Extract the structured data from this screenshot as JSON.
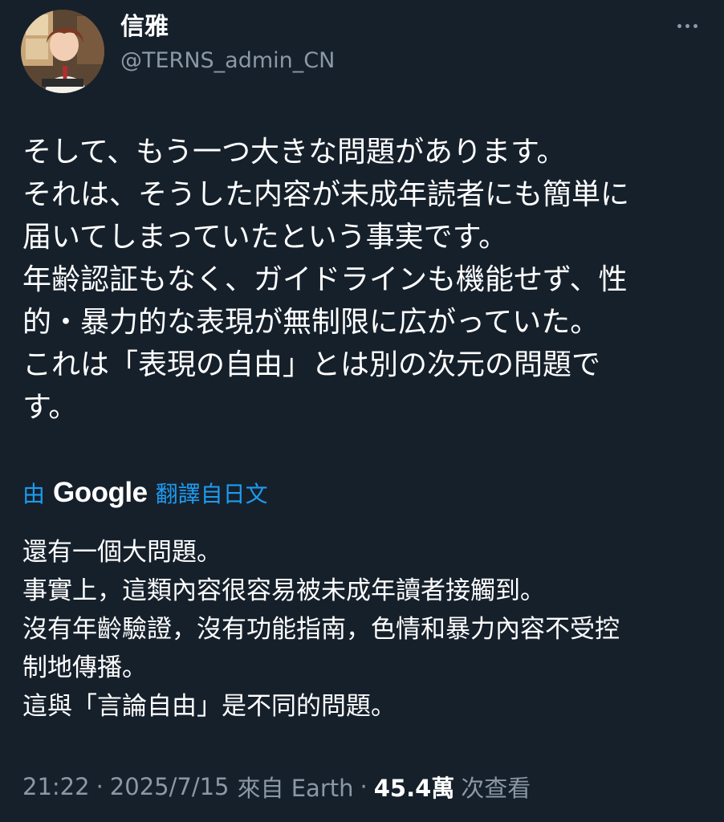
{
  "author": {
    "display_name": "信雅",
    "handle": "@TERNS_admin_CN",
    "avatar_icon": "anime-avatar-portrait"
  },
  "post": {
    "original_text": "そして、もう一つ大きな問題があります。\nそれは、そうした内容が未成年読者にも簡単に\n届いてしまっていたという事実です。\n年齢認証もなく、ガイドラインも機能せず、性\n的・暴力的な表現が無制限に広がっていた。\nこれは「表現の自由」とは別の次元の問題で\nす。",
    "translation_prefix": "由",
    "translation_provider": "Google",
    "translation_suffix": "翻譯自日文",
    "translated_text": "還有一個大問題。\n事實上，這類內容很容易被未成年讀者接觸到。\n沒有年齡驗證，沒有功能指南，色情和暴力內容不受控\n制地傳播。\n這與「言論自由」是不同的問題。"
  },
  "meta": {
    "time": "21:22",
    "separator": "·",
    "date": "2025/7/15",
    "source": "來自 Earth",
    "views_count": "45.4萬",
    "views_label": "次查看"
  },
  "colors": {
    "background": "#16202b",
    "link": "#1d9bf0",
    "secondary_text": "#8b98a5",
    "primary_text": "#ffffff"
  },
  "icons": {
    "more": "more-horizontal-icon"
  }
}
